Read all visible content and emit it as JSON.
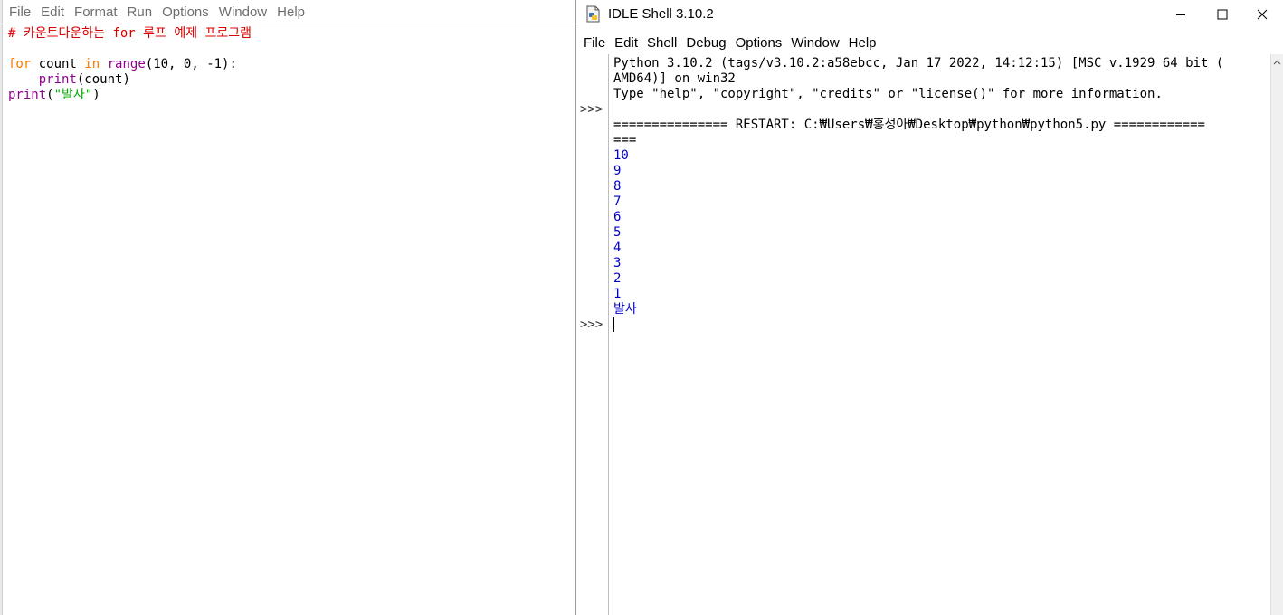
{
  "editor": {
    "menu": [
      "File",
      "Edit",
      "Format",
      "Run",
      "Options",
      "Window",
      "Help"
    ],
    "code": {
      "comment": "# 카운트다운하는 for 루프 예제 프로그램",
      "kw_for": "for",
      "var_count": " count ",
      "kw_in": "in",
      "bi_range": "range",
      "range_args": "(10, 0, -1):",
      "indent": "    ",
      "bi_print": "print",
      "print_args": "(count)",
      "bi_print2": "print",
      "paren_open": "(",
      "str_launch": "\"발사\"",
      "paren_close": ")"
    }
  },
  "shell": {
    "title": "IDLE Shell 3.10.2",
    "window_controls": {
      "minimize": "minimize-icon",
      "maximize": "maximize-icon",
      "close": "close-icon"
    },
    "menu": [
      "File",
      "Edit",
      "Shell",
      "Debug",
      "Options",
      "Window",
      "Help"
    ],
    "prompt": ">>>",
    "banner": [
      "Python 3.10.2 (tags/v3.10.2:a58ebcc, Jan 17 2022, 14:12:15) [MSC v.1929 64 bit (",
      "AMD64)] on win32",
      "Type \"help\", \"copyright\", \"credits\" or \"license()\" for more information."
    ],
    "restart": [
      "=============== RESTART: C:₩Users₩홍성아₩Desktop₩python₩python5.py ============",
      "==="
    ],
    "output": [
      "10",
      "9",
      "8",
      "7",
      "6",
      "5",
      "4",
      "3",
      "2",
      "1",
      "발사"
    ]
  }
}
